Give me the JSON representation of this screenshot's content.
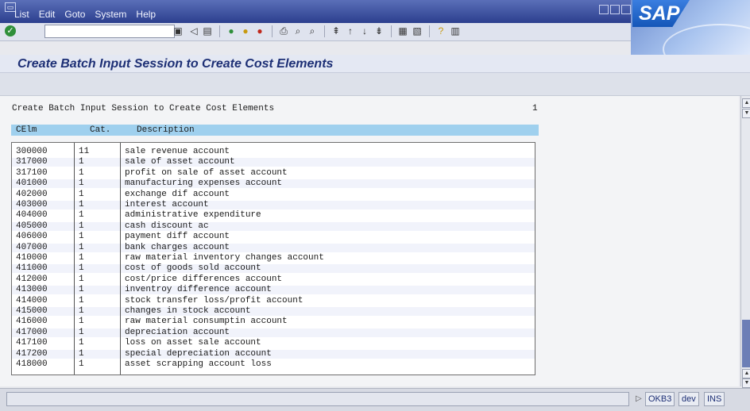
{
  "menu": [
    "List",
    "Edit",
    "Goto",
    "System",
    "Help"
  ],
  "toolbar": {
    "command_value": ""
  },
  "title": "Create Batch Input Session to Create Cost Elements",
  "list": {
    "header": "Create Batch Input Session to Create Cost Elements",
    "page": "1",
    "columns": [
      "CElm",
      "Cat.",
      "Description"
    ],
    "rows": [
      [
        "300000",
        "11",
        "sale revenue account"
      ],
      [
        "317000",
        "1",
        "sale of asset account"
      ],
      [
        "317100",
        "1",
        "profit on sale of asset account"
      ],
      [
        "401000",
        "1",
        "manufacturing expenses account"
      ],
      [
        "402000",
        "1",
        "exchange dif account"
      ],
      [
        "403000",
        "1",
        "interest account"
      ],
      [
        "404000",
        "1",
        "administrative expenditure"
      ],
      [
        "405000",
        "1",
        "cash discount ac"
      ],
      [
        "406000",
        "1",
        "payment diff account"
      ],
      [
        "407000",
        "1",
        "bank charges account"
      ],
      [
        "410000",
        "1",
        "raw material inventory changes account"
      ],
      [
        "411000",
        "1",
        "cost of goods sold account"
      ],
      [
        "412000",
        "1",
        "cost/price differences account"
      ],
      [
        "413000",
        "1",
        "inventroy difference account"
      ],
      [
        "414000",
        "1",
        "stock transfer loss/profit account"
      ],
      [
        "415000",
        "1",
        "changes in stock account"
      ],
      [
        "416000",
        "1",
        "raw material consumptin account"
      ],
      [
        "417000",
        "1",
        "depreciation account"
      ],
      [
        "417100",
        "1",
        "loss on asset sale account"
      ],
      [
        "417200",
        "1",
        "special depreciation account"
      ],
      [
        "418000",
        "1",
        "asset scrapping account loss"
      ]
    ]
  },
  "status": {
    "transaction": "OKB3",
    "system": "dev",
    "mode": "INS"
  },
  "colors": {
    "header_row": "#9fd0ee",
    "title_text": "#1d2f75",
    "menubar": "#2c3f8e"
  }
}
